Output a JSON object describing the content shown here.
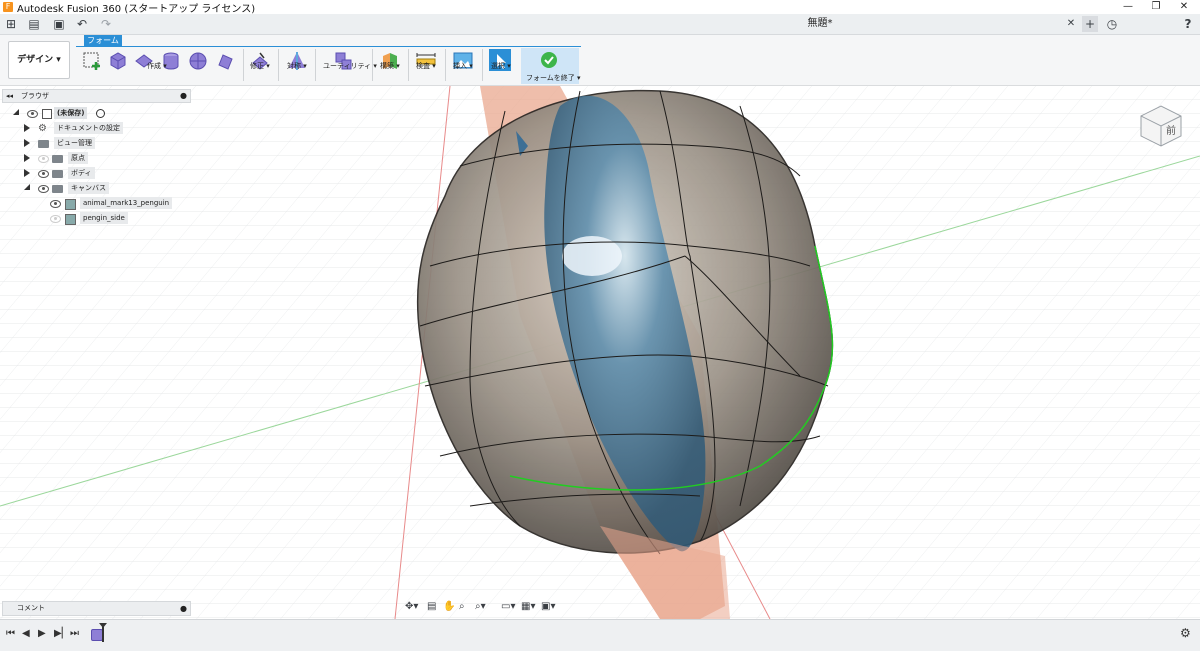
{
  "window": {
    "title": "Autodesk Fusion 360 (スタートアップ ライセンス)",
    "document_tab": "無題*",
    "minimize": "—",
    "maximize": "❐",
    "close": "✕"
  },
  "quick_access": {
    "grid": "⊞",
    "file": "▤",
    "save": "▣",
    "undo": "↶",
    "redo": "↷",
    "tab_close": "✕",
    "new_tab": "+",
    "history": "◷",
    "help": "?"
  },
  "toolbar": {
    "workspace": "デザイン ▾",
    "active_tab": "フォーム",
    "groups": [
      {
        "label": "作成 ▾"
      },
      {
        "label": "修正 ▾"
      },
      {
        "label": "対称 ▾"
      },
      {
        "label": "ユーティリティ ▾"
      },
      {
        "label": "構築 ▾"
      },
      {
        "label": "検査 ▾"
      },
      {
        "label": "挿入 ▾"
      },
      {
        "label": "選択 ▾"
      },
      {
        "label": "フォームを終了 ▾"
      }
    ]
  },
  "browser": {
    "title": "ブラウザ",
    "root": "(未保存)",
    "items": [
      {
        "label": "ドキュメントの設定"
      },
      {
        "label": "ビュー管理"
      },
      {
        "label": "原点"
      },
      {
        "label": "ボディ"
      },
      {
        "label": "キャンバス"
      },
      {
        "label": "animal_mark13_penguin"
      },
      {
        "label": "pengin_side"
      }
    ]
  },
  "comments": {
    "title": "コメント"
  },
  "viewcube": {
    "face_label": "前"
  },
  "colors": {
    "accent": "#2b8fd6",
    "finish_green": "#3db54a",
    "selection_green": "#22cc22"
  }
}
